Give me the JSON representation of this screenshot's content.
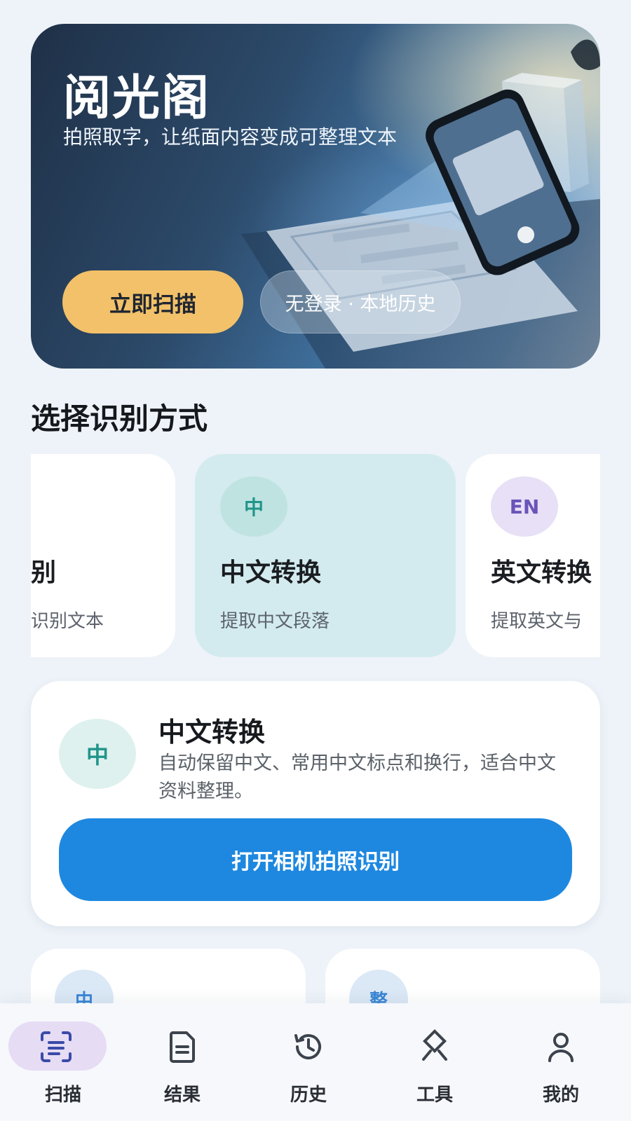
{
  "hero": {
    "title": "阅光阁",
    "subtitle": "拍照取字，让纸面内容变成可整理文本",
    "cta_label": "立即扫描",
    "pill_label": "无登录 · 本地历史"
  },
  "section": {
    "title": "选择识别方式"
  },
  "modes": [
    {
      "badge": "",
      "title": "别",
      "desc": "识别文本",
      "selected": false
    },
    {
      "badge": "中",
      "title": "中文转换",
      "desc": "提取中文段落",
      "selected": true,
      "badge_color": "#20958a",
      "badge_bg": "#bfe3e0"
    },
    {
      "badge": "EN",
      "title": "英文转换",
      "desc": "提取英文与",
      "selected": false,
      "badge_color": "#6a54b8",
      "badge_bg": "#e7e0f6"
    }
  ],
  "detail": {
    "badge": "中",
    "title": "中文转换",
    "description": "自动保留中文、常用中文标点和换行，适合中文资料整理。",
    "button_label": "打开相机拍照识别"
  },
  "peek_cards": [
    {
      "badge": "中"
    },
    {
      "badge": "整"
    }
  ],
  "nav": {
    "items": [
      {
        "label": "扫描",
        "icon": "scan-icon",
        "active": true
      },
      {
        "label": "结果",
        "icon": "document-icon",
        "active": false
      },
      {
        "label": "历史",
        "icon": "history-icon",
        "active": false
      },
      {
        "label": "工具",
        "icon": "tools-icon",
        "active": false
      },
      {
        "label": "我的",
        "icon": "profile-icon",
        "active": false
      }
    ]
  },
  "colors": {
    "background": "#eef3f9",
    "accent_yellow": "#f3c169",
    "primary_blue": "#1e88e0",
    "teal": "#20958a",
    "selected_card": "#d3ebee",
    "nav_highlight": "#e6dcf4"
  }
}
